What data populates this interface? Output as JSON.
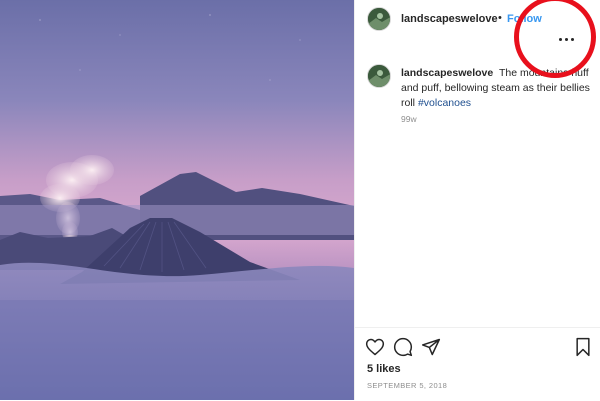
{
  "post": {
    "image_alt": "Volcano with steam above a sea of clouds at dusk",
    "header": {
      "username": "landscapeswelove",
      "separator": "•",
      "follow_label": "Follow"
    },
    "more_icon": "more-horizontal-icon",
    "caption": {
      "username": "landscapeswelove",
      "text": "The mountains huff and puff, bellowing steam as their bellies roll",
      "hashtag": "#volcanoes",
      "age": "99w"
    },
    "actions": {
      "like_icon": "heart-icon",
      "comment_icon": "comment-icon",
      "share_icon": "share-icon",
      "save_icon": "bookmark-icon"
    },
    "likes": "5 likes",
    "date": "SEPTEMBER 5, 2018"
  },
  "annotation": {
    "color": "#e8101c"
  }
}
